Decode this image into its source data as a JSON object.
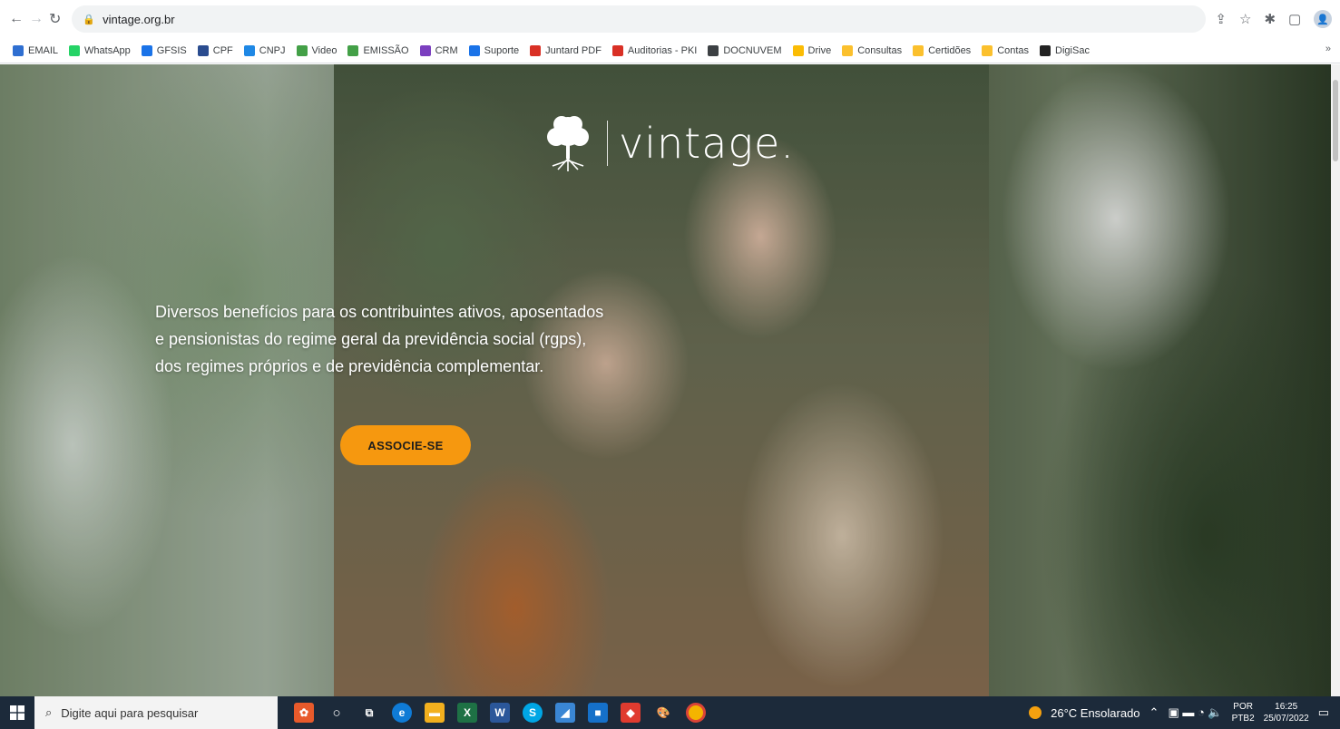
{
  "browser": {
    "url": "vintage.org.br",
    "bookmarks": [
      "EMAIL",
      "WhatsApp",
      "GFSIS",
      "CPF",
      "CNPJ",
      "Video",
      "EMISSÃO",
      "CRM",
      "Suporte",
      "Juntard PDF",
      "Auditorias - PKI",
      "DOCNUVEM",
      "Drive",
      "Consultas",
      "Certidões",
      "Contas",
      "DigiSac"
    ],
    "bookmark_colors": [
      "#2f6fd1",
      "#25d366",
      "#1a73e8",
      "#2a4c8f",
      "#1e88e5",
      "#43a047",
      "#43a047",
      "#7b3fbf",
      "#1a73e8",
      "#d93025",
      "#d93025",
      "#3c4043",
      "#fbbc04",
      "#fbc02d",
      "#fbc02d",
      "#fbc02d",
      "#222222"
    ],
    "more": "»"
  },
  "hero": {
    "logo": "vintage.",
    "lines": [
      "Diversos benefícios para os contribuintes ativos, aposentados",
      "e pensionistas do regime geral da previdência social (rgps),",
      "dos regimes próprios e de previdência complementar."
    ],
    "cta_label": "ASSOCIE-SE",
    "cta_color": "#f6980f"
  },
  "taskbar": {
    "search_placeholder": "Digite aqui para pesquisar",
    "weather": "26°C Ensolarado",
    "lang_top": "POR",
    "lang_bottom": "PTB2",
    "time": "16:25",
    "date": "25/07/2022"
  }
}
